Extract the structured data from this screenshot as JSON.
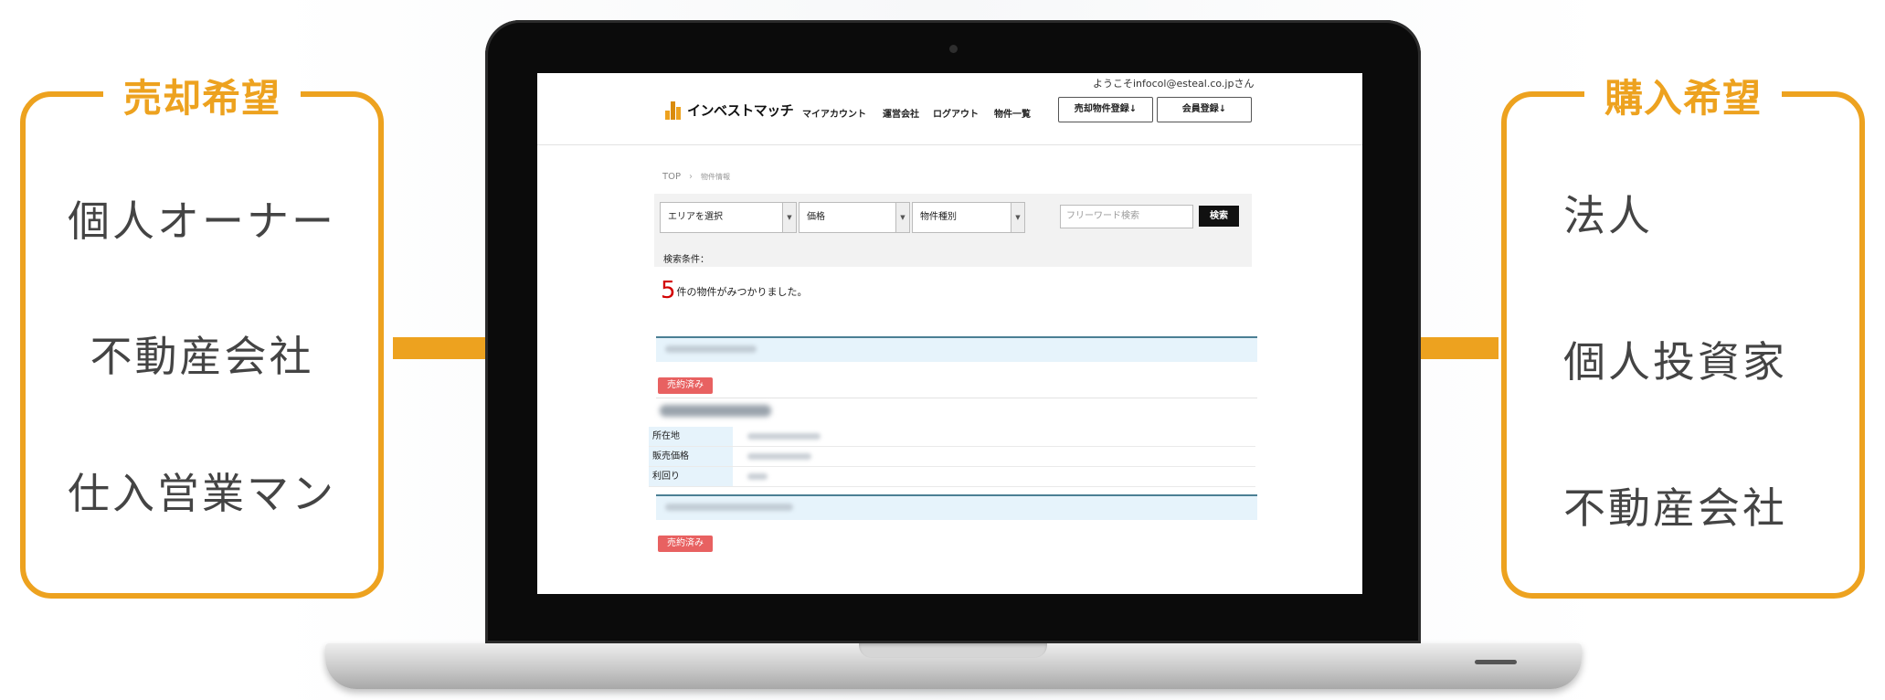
{
  "left_panel": {
    "title": "売却希望",
    "items": [
      "個人オーナー",
      "不動産会社",
      "仕入営業マン"
    ]
  },
  "right_panel": {
    "title": "購入希望",
    "items": [
      "法人",
      "個人投資家",
      "不動産会社"
    ]
  },
  "colors": {
    "accent": "#EDA21F",
    "sold_badge": "#E86161",
    "count_red": "#D20000",
    "band_bg": "#E6F3FB",
    "band_line": "#4B7F94"
  },
  "site": {
    "welcome": "ようこそinfocol@esteal.co.jpさん",
    "logo_text": "インベストマッチ",
    "nav": [
      "マイアカウント",
      "運営会社",
      "ログアウト",
      "物件一覧"
    ],
    "register_property_button": "売却物件登録↓",
    "register_member_button": "会員登録↓"
  },
  "breadcrumb": {
    "top": "TOP",
    "separator": "›",
    "current": "物件情報"
  },
  "search": {
    "area_select": "エリアを選択",
    "price_select": "価格",
    "type_select": "物件種別",
    "freeword_placeholder": "フリーワード検索",
    "search_button": "検索",
    "conditions_label": "検索条件："
  },
  "result": {
    "count": "5",
    "text": "件の物件がみつかりました。"
  },
  "listing": {
    "sold_badge": "売約済み",
    "fields": [
      "所在地",
      "販売価格",
      "利回り"
    ]
  }
}
